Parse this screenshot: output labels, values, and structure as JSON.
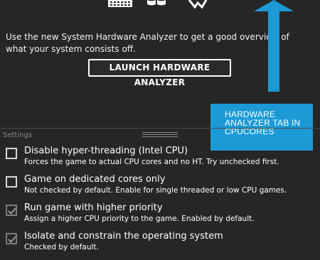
{
  "description": "Use the new System Hardware Analyzer to get a good overview of what your system consists off.",
  "launch_button": "LAUNCH HARDWARE ANALYZER",
  "callout": "HARDWARE ANALYZER TAB IN CPUCORES",
  "settings": {
    "section_label": "Settings",
    "items": [
      {
        "title": "Disable hyper-threading (Intel CPU)",
        "desc": "Forces the game to actual CPU cores and no HT. Try unchecked first.",
        "checked": false
      },
      {
        "title": "Game on dedicated cores only",
        "desc": "Not checked by default. Enable for single threaded or low CPU games.",
        "checked": false
      },
      {
        "title": "Run game with higher priority",
        "desc": "Assign a higher CPU priority to the game. Enabled by default.",
        "checked": true
      },
      {
        "title": "Isolate and constrain the operating system",
        "desc": "Checked by default.",
        "checked": true
      }
    ]
  },
  "icons": [
    "keyboard-icon",
    "windows-logo-icon",
    "network-icon"
  ],
  "colors": {
    "background": "#262626",
    "accent": "#1b9ad6",
    "text": "#ffffff",
    "muted": "#8a8a8a"
  }
}
